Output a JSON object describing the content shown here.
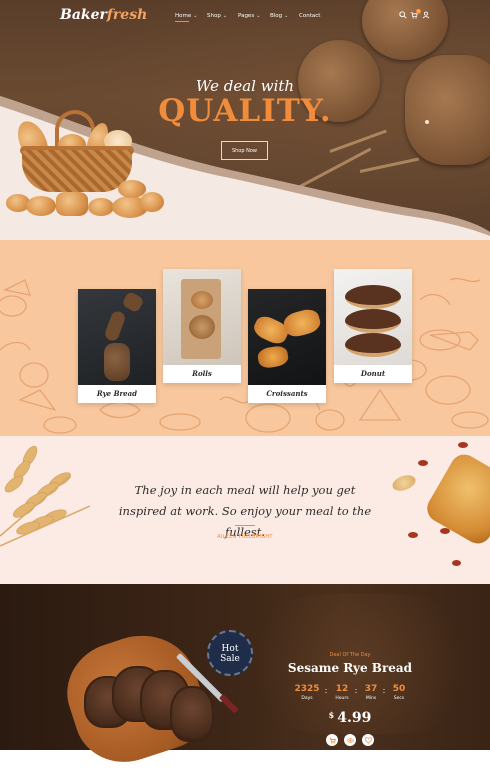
{
  "header": {
    "logo_part1": "Baker",
    "logo_part2": "fresh",
    "nav": [
      {
        "label": "Home",
        "arrow": "⌄"
      },
      {
        "label": "Shop",
        "arrow": "⌄"
      },
      {
        "label": "Pages",
        "arrow": "⌄"
      },
      {
        "label": "Blog",
        "arrow": "⌄"
      },
      {
        "label": "Contact",
        "arrow": ""
      }
    ],
    "icons": [
      "search-icon",
      "cart-icon",
      "user-icon"
    ],
    "cart_count": "0"
  },
  "hero": {
    "subtitle": "We deal with",
    "title": "QUALITY.",
    "button": "Shop Now",
    "accent": "#f08c3c"
  },
  "categories": [
    {
      "label": "Rye Bread"
    },
    {
      "label": "Rolls"
    },
    {
      "label": "Croissants"
    },
    {
      "label": "Donut"
    }
  ],
  "testimonial": {
    "quote": "The joy in each meal will help you get inspired at work. So enjoy your meal to the fullest.",
    "author": "AILEEN FULLBRIGHT"
  },
  "deal": {
    "badge_line1": "Hot",
    "badge_line2": "Sale",
    "tag": "Deal Of The Day",
    "title": "Sesame Rye Bread",
    "countdown": [
      {
        "value": "2325",
        "label": "Days"
      },
      {
        "value": "12",
        "label": "Hours"
      },
      {
        "value": "37",
        "label": "Mins"
      },
      {
        "value": "50",
        "label": "Secs"
      }
    ],
    "separator": ":",
    "currency": "$",
    "price": "4.99",
    "actions": [
      "cart-icon",
      "eye-icon",
      "heart-icon"
    ]
  }
}
